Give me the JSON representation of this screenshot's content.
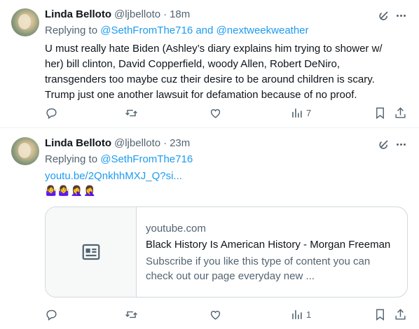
{
  "tweets": [
    {
      "author_name": "Linda Belloto",
      "handle": "@ljbelloto",
      "separator": "·",
      "time": "18m",
      "replying_prefix": "Replying to ",
      "mention_1": "@SethFromThe716",
      "mention_joiner": " and ",
      "mention_2": "@nextweekweather",
      "text": "U must really hate Biden (Ashley’s diary explains him trying to shower w/ her) bill clinton, David Copperfield, woody Allen, Robert DeNiro, transgenders too maybe cuz their desire to be around children is scary. Trump just one another lawsuit for defamation because of no proof.",
      "views": "7"
    },
    {
      "author_name": "Linda Belloto",
      "handle": "@ljbelloto",
      "separator": "·",
      "time": "23m",
      "replying_prefix": "Replying to ",
      "mention_1": "@SethFromThe716",
      "link": "youtu.be/2QnkhhMXJ_Q?si...",
      "emojis": "🤷‍♀️🤷‍♀️🤦‍♀️🤦‍♀️",
      "card": {
        "domain": "youtube.com",
        "title": "Black History Is American History - Morgan Freeman",
        "description": "Subscribe if you like this type of content you can check out our page everyday new ..."
      },
      "views": "1"
    }
  ],
  "icons": {
    "grok": "grok-icon",
    "more": "more-icon",
    "reply": "reply-icon",
    "repost": "repost-icon",
    "like": "heart-icon",
    "views": "views-icon",
    "bookmark": "bookmark-icon",
    "share": "share-icon",
    "card_placeholder": "article-icon"
  },
  "colors": {
    "link": "#1d9bf0",
    "secondary_text": "#536471",
    "primary_text": "#0f1419"
  }
}
